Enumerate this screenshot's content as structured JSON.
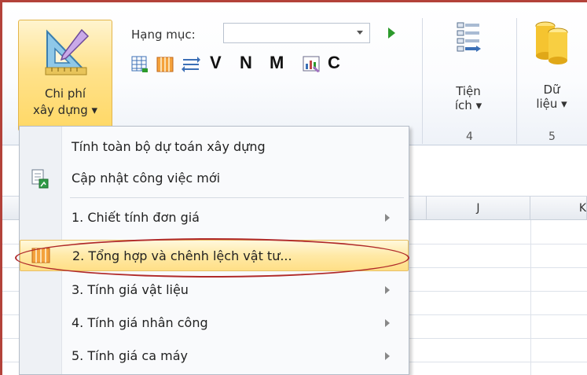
{
  "ribbon": {
    "main_button": {
      "line1": "Chi phí",
      "line2": "xây dựng ▾"
    },
    "hang_muc_label": "Hạng mục:",
    "hang_muc_value": "",
    "letters": [
      "V",
      "N",
      "M",
      "C"
    ],
    "tien_ich": {
      "line1": "Tiện",
      "line2": "ích ▾",
      "group": "4"
    },
    "du_lieu": {
      "line1": "Dữ",
      "line2": "liệu ▾",
      "group": "5"
    }
  },
  "grid": {
    "columns": [
      "J",
      "K"
    ]
  },
  "menu": {
    "items": [
      {
        "label": "Tính toàn bộ dự toán xây dựng"
      },
      {
        "label": "Cập nhật công việc mới"
      },
      {
        "label": "1. Chiết tính đơn giá"
      },
      {
        "label": "2. Tổng hợp và chênh lệch vật tư..."
      },
      {
        "label": "3. Tính giá vật liệu"
      },
      {
        "label": "4. Tính giá nhân công"
      },
      {
        "label": "5. Tính giá ca máy"
      }
    ],
    "highlighted_index": 3
  },
  "colors": {
    "frame": "#b3423a",
    "highlight": "#ffe9a6",
    "ellipse": "#b02a2a"
  }
}
